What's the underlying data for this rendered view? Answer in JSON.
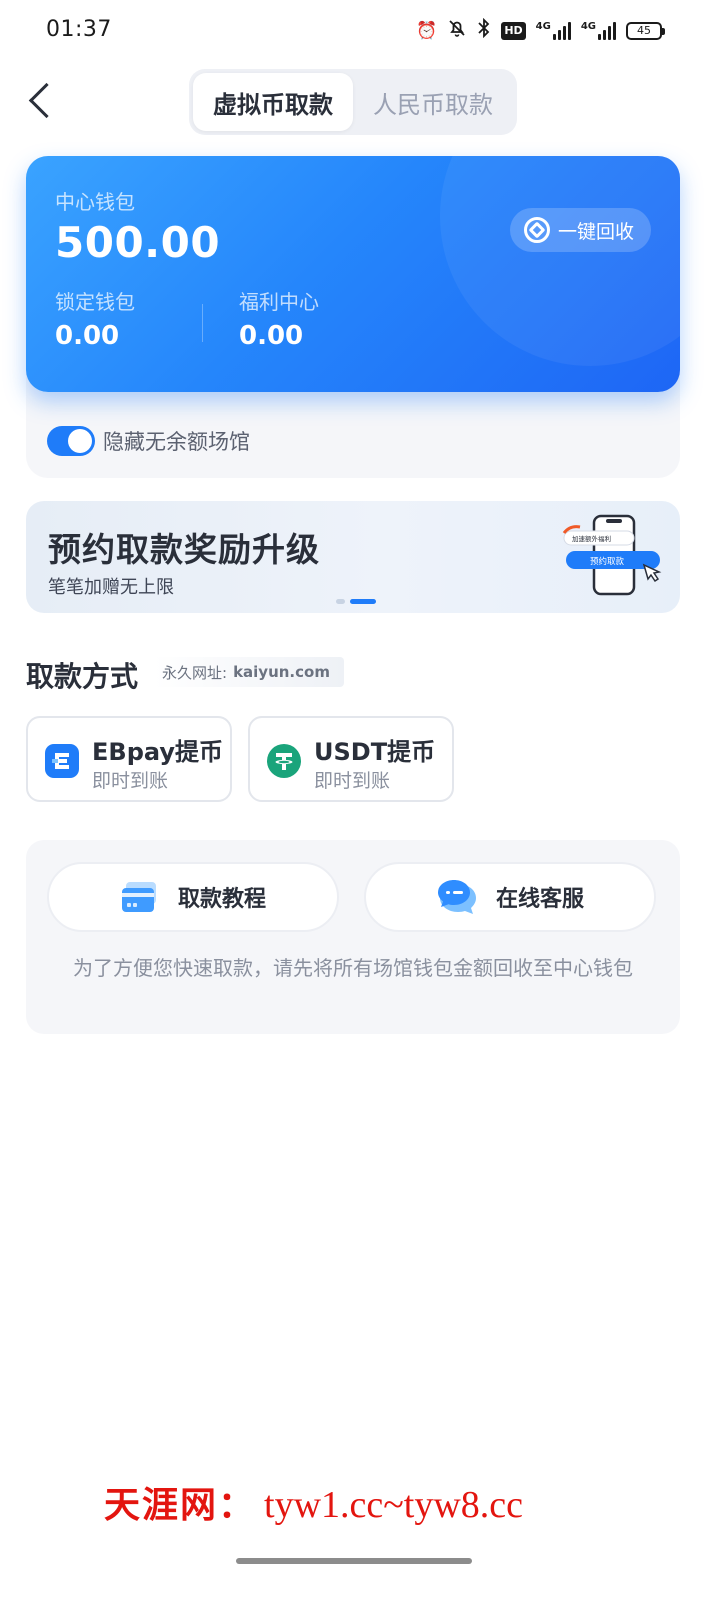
{
  "status_bar": {
    "time": "01:37",
    "hd_label": "HD",
    "network_label_1": "4G",
    "network_label_2": "4G",
    "battery": "45"
  },
  "header": {
    "tabs": [
      {
        "label": "虚拟币取款",
        "active": true
      },
      {
        "label": "人民币取款",
        "active": false
      }
    ]
  },
  "wallet": {
    "main_label": "中心钱包",
    "main_value": "500.00",
    "recycle_label": "一键回收",
    "locked_label": "锁定钱包",
    "locked_value": "0.00",
    "welfare_label": "福利中心",
    "welfare_value": "0.00",
    "hide_empty_label": "隐藏无余额场馆",
    "hide_empty_enabled": true
  },
  "banner": {
    "title": "预约取款奖励升级",
    "subtitle": "笔笔加赠无上限",
    "art_tag": "加速额外福利",
    "art_button": "预约取款",
    "slide_count": 2,
    "active_slide": 2
  },
  "withdraw": {
    "section_title": "取款方式",
    "permanent_url_prefix": "永久网址:",
    "permanent_url": "kaiyun.com",
    "methods": [
      {
        "name": "EBpay提币",
        "subtitle": "即时到账",
        "icon": "ebpay-icon",
        "color": "#1f7cf9"
      },
      {
        "name": "USDT提币",
        "subtitle": "即时到账",
        "icon": "tether-icon",
        "color": "#1aa47b"
      }
    ]
  },
  "help": {
    "tutorial_label": "取款教程",
    "support_label": "在线客服",
    "note": "为了方便您快速取款，请先将所有场馆钱包金额回收至中心钱包"
  },
  "watermark": {
    "cn": "天涯网：",
    "url": "tyw1.cc~tyw8.cc"
  },
  "colors": {
    "accent": "#1f7cf9",
    "card_gradient_start": "#3aa3ff",
    "card_gradient_end": "#1e66f5",
    "watermark": "#e3150f"
  }
}
